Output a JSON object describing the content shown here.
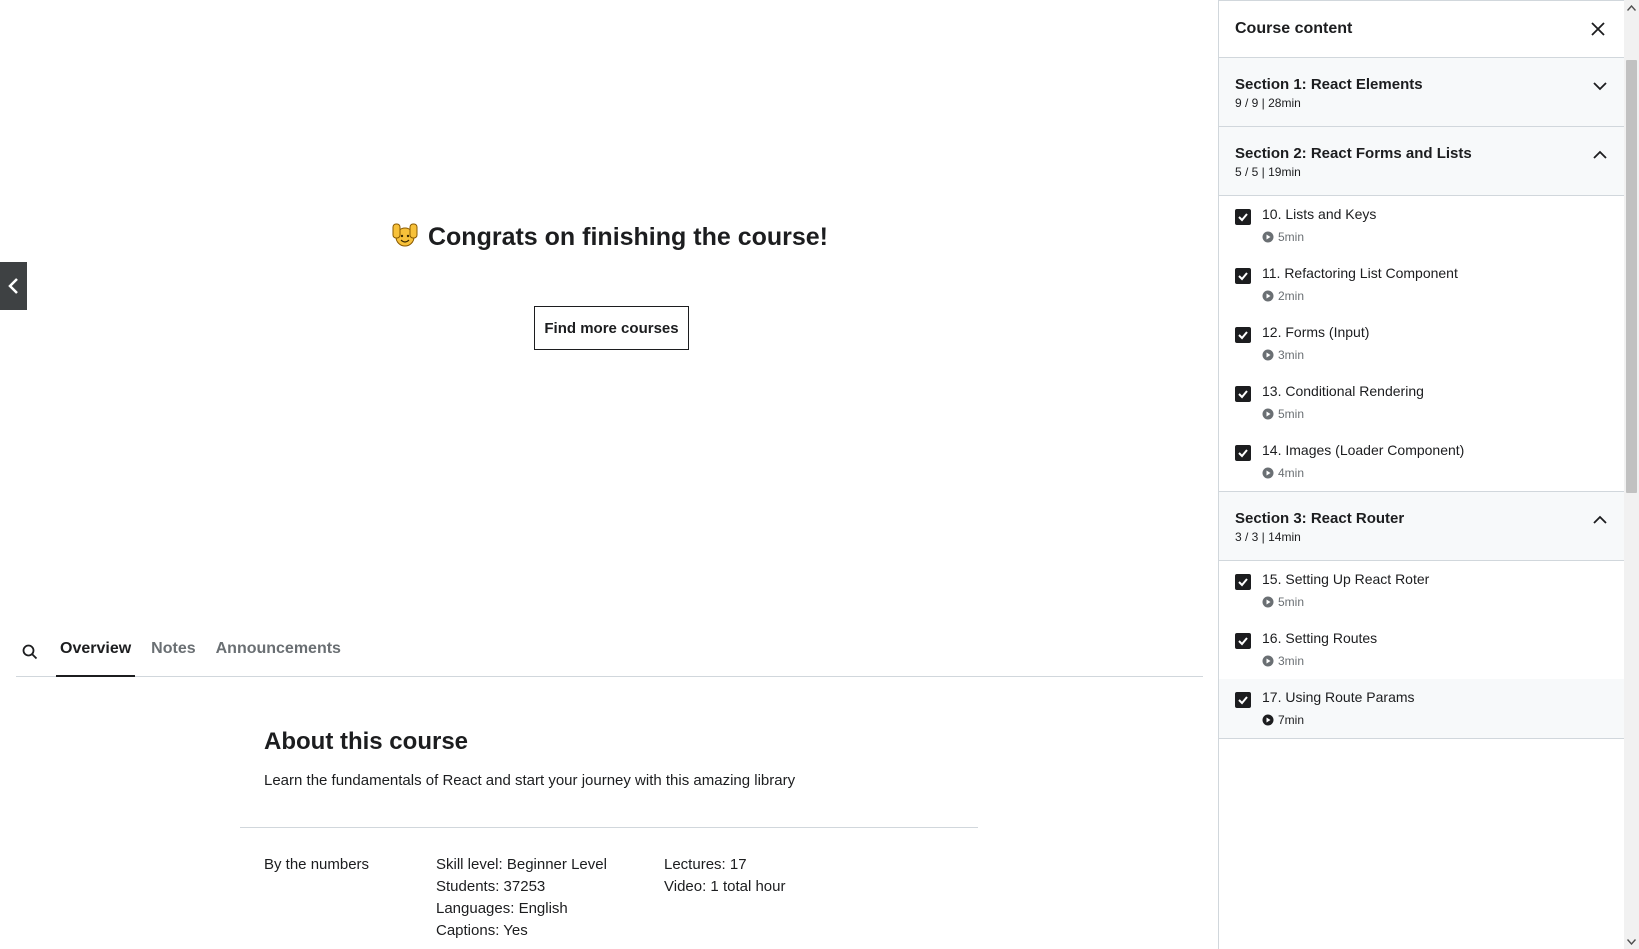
{
  "main": {
    "congrats_text": "Congrats on finishing the course!",
    "find_more_label": "Find more courses"
  },
  "tabs": [
    {
      "label": "Overview",
      "active": true
    },
    {
      "label": "Notes",
      "active": false
    },
    {
      "label": "Announcements",
      "active": false
    }
  ],
  "about": {
    "title": "About this course",
    "description": "Learn the fundamentals of React and start your journey with this amazing library",
    "numbers_label": "By the numbers",
    "skill_level": "Skill level: Beginner Level",
    "students": "Students: 37253",
    "languages": "Languages: English",
    "captions": "Captions: Yes",
    "lectures": "Lectures: 17",
    "video": "Video: 1 total hour"
  },
  "sidebar": {
    "title": "Course content",
    "sections": [
      {
        "title": "Section 1: React Elements",
        "meta": "9 / 9 | 28min",
        "expanded": false,
        "lectures": []
      },
      {
        "title": "Section 2: React Forms and Lists",
        "meta": "5 / 5 | 19min",
        "expanded": true,
        "lectures": [
          {
            "title": "10. Lists and Keys",
            "duration": "5min"
          },
          {
            "title": "11. Refactoring List Component",
            "duration": "2min"
          },
          {
            "title": "12. Forms (Input)",
            "duration": "3min"
          },
          {
            "title": "13. Conditional Rendering",
            "duration": "5min"
          },
          {
            "title": "14. Images (Loader Component)",
            "duration": "4min"
          }
        ]
      },
      {
        "title": "Section 3: React Router",
        "meta": "3 / 3 | 14min",
        "expanded": true,
        "lectures": [
          {
            "title": "15. Setting Up React Roter",
            "duration": "5min"
          },
          {
            "title": "16. Setting Routes",
            "duration": "3min"
          },
          {
            "title": "17. Using Route Params",
            "duration": "7min"
          }
        ]
      }
    ]
  },
  "colors": {
    "text": "#1c1d1f",
    "muted": "#6a6f73",
    "border": "#d1d7dc",
    "section_bg": "#f7f9fa",
    "toggle_bg": "#3e4143"
  },
  "icons": {
    "search": "search-icon",
    "close": "close-icon",
    "chevron_down": "chevron-down-icon",
    "chevron_up": "chevron-up-icon",
    "chevron_left": "chevron-left-icon",
    "checkbox": "checkbox-checked-icon",
    "play": "play-circle-icon",
    "celebrate": "raising-hands-icon"
  }
}
